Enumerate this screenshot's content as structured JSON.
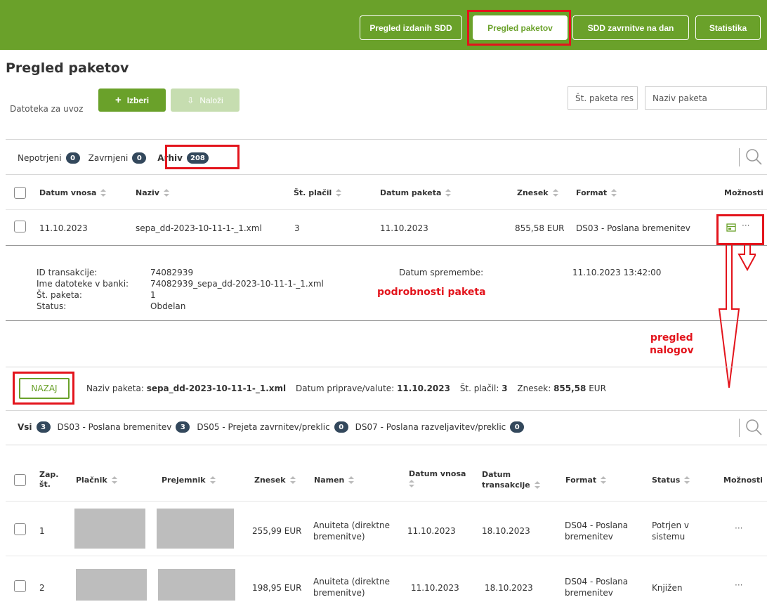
{
  "nav": {
    "items": [
      {
        "label": "Pregled izdanih SDD",
        "active": false
      },
      {
        "label": "Pregled paketov",
        "active": true
      },
      {
        "label": "SDD zavrnitve na dan",
        "active": false
      },
      {
        "label": "Statistika",
        "active": false
      }
    ]
  },
  "page": {
    "title": "Pregled paketov"
  },
  "upload": {
    "label": "Datoteka za uvoz",
    "choose_label": "Izberi",
    "upload_label": "Naloži"
  },
  "filters": {
    "package_no_placeholder": "Št. paketa res",
    "package_name_placeholder": "Naziv paketa"
  },
  "tabs": {
    "unconfirmed_label": "Nepotrjeni",
    "unconfirmed_count": "0",
    "rejected_label": "Zavrnjeni",
    "rejected_count": "0",
    "archive_label": "Arhiv",
    "archive_count": "208"
  },
  "packages_table": {
    "headers": {
      "date": "Datum vnosa",
      "name": "Naziv",
      "payer_count": "Št. plačil",
      "package_date": "Datum paketa",
      "amount": "Znesek",
      "format": "Format",
      "options": "Možnosti"
    },
    "row": {
      "date": "11.10.2023",
      "name": "sepa_dd-2023-10-11-1-_1.xml",
      "payer_count": "3",
      "package_date": "11.10.2023",
      "amount": "855,58 EUR",
      "format": "DS03 - Poslana bremenitev",
      "more": "···"
    }
  },
  "details": {
    "tx_id_label": "ID transakcije:",
    "tx_id": "74082939",
    "bank_file_label": "Ime datoteke v banki:",
    "bank_file": "74082939_sepa_dd-2023-10-11-1-_1.xml",
    "package_no_label": "Št. paketa:",
    "package_no": "1",
    "status_label": "Status:",
    "status": "Obdelan",
    "changed_label": "Datum spremembe:",
    "changed": "11.10.2023 13:42:00"
  },
  "annotations": {
    "package_details": "podrobnosti paketa",
    "orders_line1": "pregled",
    "orders_line2": "nalogov"
  },
  "summary": {
    "back_label": "NAZAJ",
    "name_label": "Naziv paketa:",
    "name_value": "sepa_dd-2023-10-11-1-_1.xml",
    "date_label": "Datum priprave/valute:",
    "date_value": "11.10.2023",
    "count_label": "Št. plačil:",
    "count_value": "3",
    "amount_label": "Znesek:",
    "amount_value": "855,58",
    "amount_currency": "EUR"
  },
  "order_filters": {
    "all_label": "Vsi",
    "all_count": "3",
    "ds03_label": "DS03 - Poslana bremenitev",
    "ds03_count": "3",
    "ds05_label": "DS05 - Prejeta zavrnitev/preklic",
    "ds05_count": "0",
    "ds07_label": "DS07 - Poslana razveljavitev/preklic",
    "ds07_count": "0"
  },
  "orders_table": {
    "headers": {
      "seq_1": "Zap.",
      "seq_2": "št.",
      "payer": "Plačnik",
      "recipient": "Prejemnik",
      "amount": "Znesek",
      "purpose": "Namen",
      "entry_date": "Datum vnosa",
      "tx_date_1": "Datum",
      "tx_date_2": "transakcije",
      "format": "Format",
      "status": "Status",
      "options": "Možnosti"
    },
    "rows": [
      {
        "seq": "1",
        "amount": "255,99 EUR",
        "purpose_1": "Anuiteta (direktne",
        "purpose_2": "bremenitve)",
        "entry_date": "11.10.2023",
        "tx_date": "18.10.2023",
        "format_1": "DS04 - Poslana",
        "format_2": "bremenitev",
        "status_1": "Potrjen v",
        "status_2": "sistemu",
        "more": "···"
      },
      {
        "seq": "2",
        "amount": "198,95 EUR",
        "purpose_1": "Anuiteta (direktne",
        "purpose_2": "bremenitve)",
        "entry_date": "11.10.2023",
        "tx_date": "18.10.2023",
        "format_1": "DS04 - Poslana",
        "format_2": "bremenitev",
        "status_1": "Knjižen",
        "status_2": "",
        "more": "···"
      }
    ]
  },
  "colors": {
    "brand": "#6aa12a",
    "highlight": "#e3141c",
    "badge": "#33485c"
  }
}
